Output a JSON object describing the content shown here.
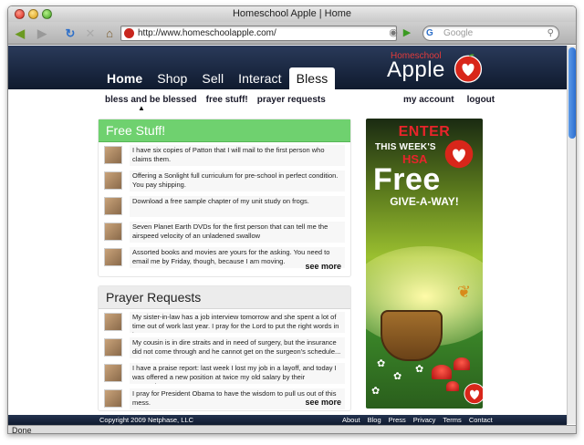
{
  "browser": {
    "title": "Homeschool Apple | Home",
    "url": "http://www.homeschoolapple.com/",
    "search_placeholder": "Google",
    "status": "Done"
  },
  "site": {
    "logo_small": "Homeschool",
    "logo_big": "Apple",
    "nav": [
      "Home",
      "Shop",
      "Sell",
      "Interact",
      "Bless"
    ],
    "active_nav": "Bless",
    "subnav_left": [
      "bless and be blessed",
      "free stuff!",
      "prayer requests"
    ],
    "subnav_right": [
      "my account",
      "logout"
    ]
  },
  "free_stuff": {
    "title": "Free Stuff!",
    "items": [
      "I have six copies of Patton that I will mail to the first person who claims them.",
      "Offering a Sonlight full curriculum for pre-school in perfect condition. You pay shipping.",
      "Download a free sample chapter of my unit study on frogs.",
      "Seven Planet Earth DVDs for the first person that can tell me the airspeed velocity of an unladened swallow",
      "Assorted books and movies are yours for the asking. You need to email me by Friday, though, because I am moving."
    ],
    "see_more": "see more"
  },
  "prayer_requests": {
    "title": "Prayer Requests",
    "items": [
      "My sister-in-law has a job interview tomorrow and she spent a lot of time out of work last year. I pray for the Lord to put the right words in her...",
      "My cousin is in dire straits and in need of surgery, but the insurance did not come through and he cannot get on the surgeon's schedule...",
      "I have a praise report: last week I lost my job in a layoff, and today I was offered a new position at twice my old salary by their competitor...",
      "I pray for President Obama to have the wisdom to pull us out of this mess."
    ],
    "see_more": "see more"
  },
  "ad": {
    "enter": "ENTER",
    "this_weeks": "THIS WEEK'S",
    "hsa": "HSA",
    "free": "Free",
    "give": "GIVE-A-WAY!"
  },
  "footer": {
    "copyright": "Copyright 2009 Netphase, LLC",
    "links": [
      "About",
      "Blog",
      "Press",
      "Privacy",
      "Terms",
      "Contact"
    ]
  },
  "colors": {
    "header_navy": "#1a2742",
    "free_green": "#6fd16f",
    "apple_red": "#d8261a"
  }
}
